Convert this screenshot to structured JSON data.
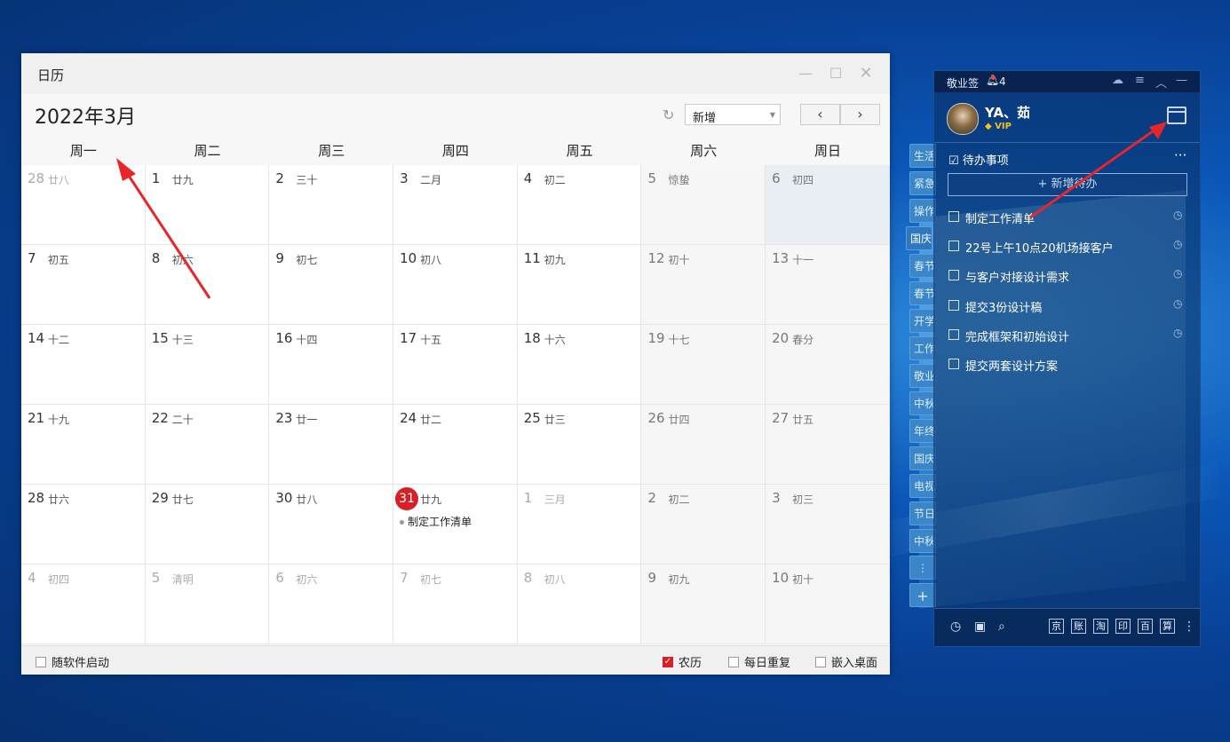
{
  "window": {
    "title": "日历",
    "min_icon": "minimize-icon",
    "max_icon": "maximize-icon",
    "close_icon": "close-icon"
  },
  "toolbar": {
    "month_title": "2022年3月",
    "select_value": "新增",
    "prev_label": "‹",
    "next_label": "›"
  },
  "weekdays": [
    "周一",
    "周二",
    "周三",
    "周四",
    "周五",
    "周六",
    "周日"
  ],
  "days": [
    {
      "d": "28",
      "l": "廿八",
      "other": true
    },
    {
      "d": "1",
      "l": "廿九"
    },
    {
      "d": "2",
      "l": "三十"
    },
    {
      "d": "3",
      "l": "二月"
    },
    {
      "d": "4",
      "l": "初二"
    },
    {
      "d": "5",
      "l": "惊蛰"
    },
    {
      "d": "6",
      "l": "初四",
      "hl": true
    },
    {
      "d": "7",
      "l": "初五"
    },
    {
      "d": "8",
      "l": "初六"
    },
    {
      "d": "9",
      "l": "初七"
    },
    {
      "d": "10",
      "l": "初八"
    },
    {
      "d": "11",
      "l": "初九"
    },
    {
      "d": "12",
      "l": "初十"
    },
    {
      "d": "13",
      "l": "十一"
    },
    {
      "d": "14",
      "l": "十二"
    },
    {
      "d": "15",
      "l": "十三"
    },
    {
      "d": "16",
      "l": "十四"
    },
    {
      "d": "17",
      "l": "十五"
    },
    {
      "d": "18",
      "l": "十六"
    },
    {
      "d": "19",
      "l": "十七"
    },
    {
      "d": "20",
      "l": "春分"
    },
    {
      "d": "21",
      "l": "十九"
    },
    {
      "d": "22",
      "l": "二十"
    },
    {
      "d": "23",
      "l": "廿一"
    },
    {
      "d": "24",
      "l": "廿二"
    },
    {
      "d": "25",
      "l": "廿三"
    },
    {
      "d": "26",
      "l": "廿四"
    },
    {
      "d": "27",
      "l": "廿五"
    },
    {
      "d": "28",
      "l": "廿六"
    },
    {
      "d": "29",
      "l": "廿七"
    },
    {
      "d": "30",
      "l": "廿八"
    },
    {
      "d": "31",
      "l": "廿九",
      "today": true,
      "event": "制定工作清单"
    },
    {
      "d": "1",
      "l": "三月",
      "other": true
    },
    {
      "d": "2",
      "l": "初二",
      "other": true
    },
    {
      "d": "3",
      "l": "初三",
      "other": true
    },
    {
      "d": "4",
      "l": "初四",
      "other": true
    },
    {
      "d": "5",
      "l": "清明",
      "other": true
    },
    {
      "d": "6",
      "l": "初六",
      "other": true
    },
    {
      "d": "7",
      "l": "初七",
      "other": true
    },
    {
      "d": "8",
      "l": "初八",
      "other": true
    },
    {
      "d": "9",
      "l": "初九",
      "other": true
    },
    {
      "d": "10",
      "l": "初十",
      "other": true
    }
  ],
  "footer": {
    "autostart": "随软件启动",
    "lunar": "农历",
    "daily_repeat": "每日重复",
    "embed_desktop": "嵌入桌面"
  },
  "tags": [
    "生活",
    "紧急",
    "操作",
    "国庆",
    "春节",
    "春节",
    "开学",
    "工作",
    "敬业",
    "中秋",
    "年终",
    "国庆",
    "电视",
    "节日",
    "中秋"
  ],
  "note": {
    "app_name": "敬业签",
    "notif_count": "4",
    "user_name": "YA、茹",
    "vip": "VIP",
    "todo_header": "待办事项",
    "add_todo": "+ 新增待办",
    "todos": [
      "制定工作清单",
      "22号上午10点20机场接客户",
      "与客户对接设计需求",
      "提交3份设计稿",
      "完成框架和初始设计",
      "提交两套设计方案"
    ],
    "bottom_keys": [
      "京",
      "账",
      "淘",
      "印",
      "百",
      "算"
    ]
  }
}
